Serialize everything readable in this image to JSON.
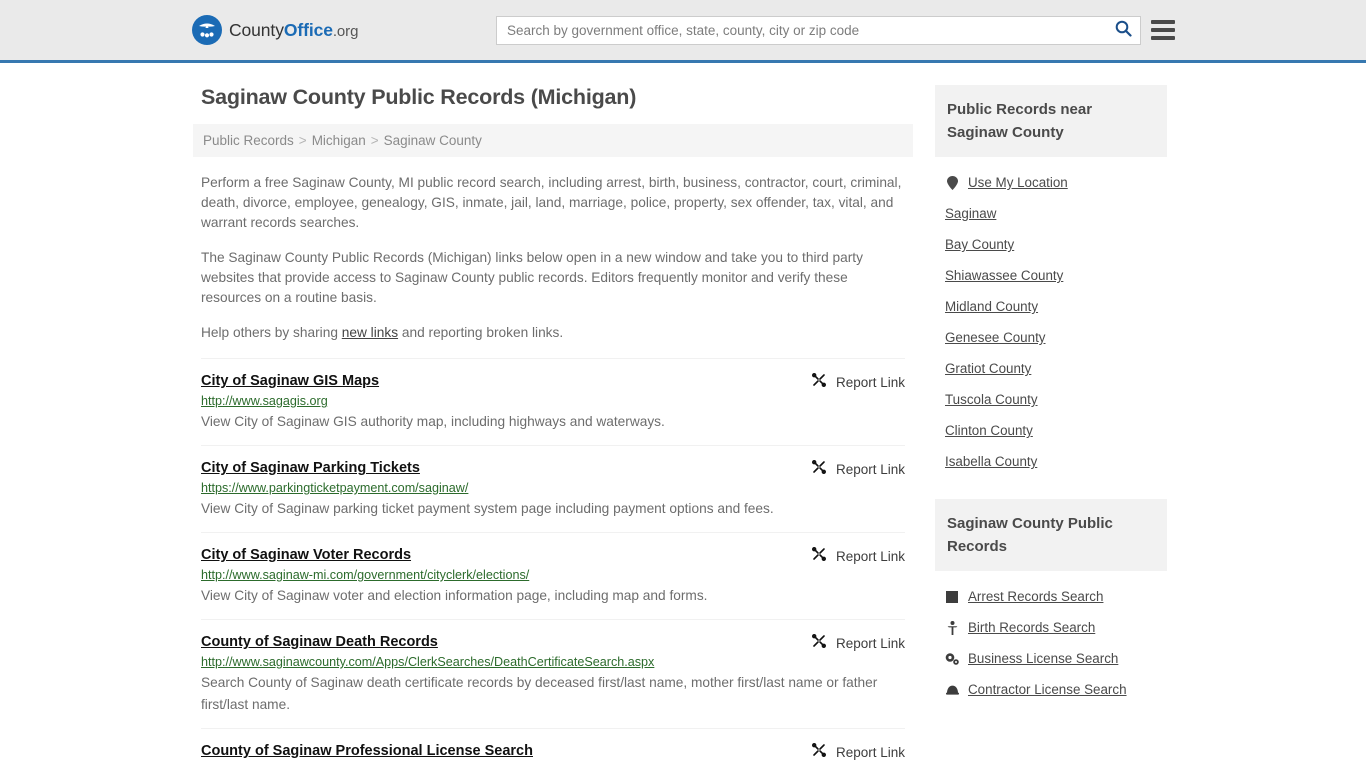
{
  "header": {
    "logo": {
      "name_part1": "County",
      "name_part2": "Office",
      "name_part3": ".org",
      "icon": "eagle-shield-logo"
    },
    "search": {
      "placeholder": "Search by government office, state, county, city or zip code",
      "value": "",
      "search_icon": "search-icon"
    },
    "menu_icon": "hamburger-menu-icon"
  },
  "main": {
    "title": "Saginaw County Public Records (Michigan)",
    "breadcrumb": [
      {
        "label": "Public Records"
      },
      {
        "label": "Michigan"
      },
      {
        "label": "Saginaw County"
      }
    ],
    "breadcrumb_separator": ">",
    "paragraphs": {
      "p1": "Perform a free Saginaw County, MI public record search, including arrest, birth, business, contractor, court, criminal, death, divorce, employee, genealogy, GIS, inmate, jail, land, marriage, police, property, sex offender, tax, vital, and warrant records searches.",
      "p2": "The Saginaw County Public Records (Michigan) links below open in a new window and take you to third party websites that provide access to Saginaw County public records. Editors frequently monitor and verify these resources on a routine basis.",
      "p3_before": "Help others by sharing ",
      "p3_link": "new links",
      "p3_after": " and reporting broken links."
    },
    "report_label": "Report Link",
    "report_icon": "broken-link-icon",
    "links": [
      {
        "title": "City of Saginaw GIS Maps",
        "url": "http://www.sagagis.org",
        "description": "View City of Saginaw GIS authority map, including highways and waterways."
      },
      {
        "title": "City of Saginaw Parking Tickets",
        "url": "https://www.parkingticketpayment.com/saginaw/",
        "description": "View City of Saginaw parking ticket payment system page including payment options and fees."
      },
      {
        "title": "City of Saginaw Voter Records",
        "url": "http://www.saginaw-mi.com/government/cityclerk/elections/",
        "description": "View City of Saginaw voter and election information page, including map and forms."
      },
      {
        "title": "County of Saginaw Death Records",
        "url": "http://www.saginawcounty.com/Apps/ClerkSearches/DeathCertificateSearch.aspx",
        "description": "Search County of Saginaw death certificate records by deceased first/last name, mother first/last name or father first/last name."
      },
      {
        "title": "County of Saginaw Professional License Search",
        "url": "",
        "description": ""
      }
    ]
  },
  "sidebar": {
    "nearby_card": {
      "title": "Public Records near Saginaw County",
      "items": [
        {
          "label": "Use My Location",
          "icon": "map-pin-icon"
        },
        {
          "label": "Saginaw",
          "icon": ""
        },
        {
          "label": "Bay County",
          "icon": ""
        },
        {
          "label": "Shiawassee County",
          "icon": ""
        },
        {
          "label": "Midland County",
          "icon": ""
        },
        {
          "label": "Genesee County",
          "icon": ""
        },
        {
          "label": "Gratiot County",
          "icon": ""
        },
        {
          "label": "Tuscola County",
          "icon": ""
        },
        {
          "label": "Clinton County",
          "icon": ""
        },
        {
          "label": "Isabella County",
          "icon": ""
        }
      ]
    },
    "records_card": {
      "title": "Saginaw County Public Records",
      "items": [
        {
          "label": "Arrest Records Search",
          "icon": "square-icon"
        },
        {
          "label": "Birth Records Search",
          "icon": "child-icon"
        },
        {
          "label": "Business License Search",
          "icon": "cogs-icon"
        },
        {
          "label": "Contractor License Search",
          "icon": "hard-hat-icon"
        }
      ]
    }
  },
  "colors": {
    "header_bg": "#eaeaea",
    "accent_blue": "#3778b0",
    "logo_blue": "#1b6bb5",
    "url_green": "#2c6b2c",
    "card_head_bg": "#f2f2f2"
  }
}
